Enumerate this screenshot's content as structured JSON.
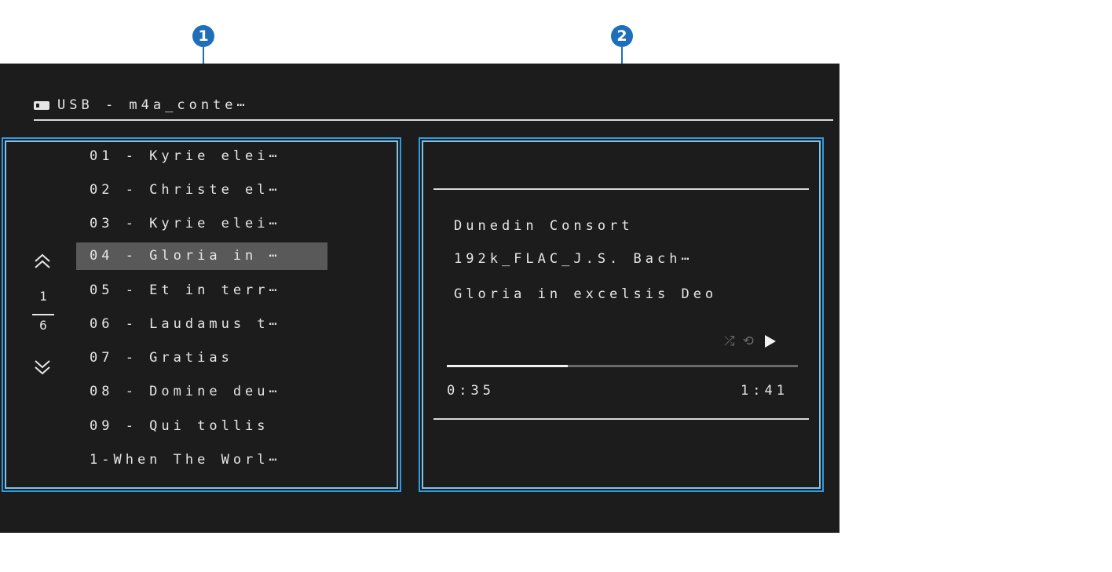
{
  "callouts": [
    "1",
    "2"
  ],
  "source": {
    "icon": "usb-drive-icon",
    "label": "USB - m4a_conte⋯"
  },
  "tracks": [
    "01 - Kyrie elei⋯",
    "02 - Christe el⋯",
    "03 - Kyrie elei⋯",
    "04 - Gloria in ⋯",
    "05 - Et in terr⋯",
    "06 - Laudamus t⋯",
    "07 - Gratias",
    "08 - Domine deu⋯",
    "09 - Qui tollis",
    "1-When The Worl⋯"
  ],
  "selected_track_index": 3,
  "pager": {
    "up_icon": "double-chevron-up-icon",
    "current": "1",
    "total": "6",
    "down_icon": "double-chevron-down-icon"
  },
  "now_playing": {
    "artist": "Dunedin Consort",
    "album": "192k_FLAC_J.S. Bach⋯",
    "title": "Gloria in excelsis Deo",
    "shuffle_icon": "shuffle-icon",
    "repeat_icon": "repeat-icon",
    "play_icon": "play-icon",
    "progress": 0.345,
    "elapsed": "0:35",
    "total": "1:41"
  },
  "colors": {
    "callout": "#1e6fb8",
    "highlight": "#2f9be0",
    "background": "#1c1c1c",
    "selected_row": "#595959"
  }
}
